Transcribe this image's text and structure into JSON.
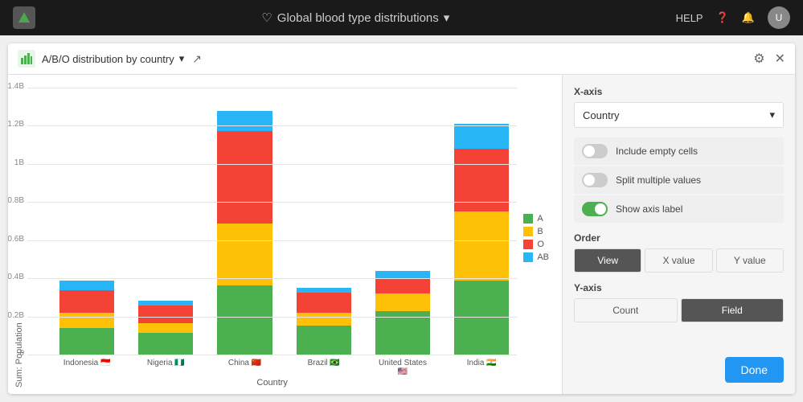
{
  "topbar": {
    "title": "Global blood type distributions",
    "help_label": "HELP",
    "heart_icon": "♡",
    "chevron_icon": "▾"
  },
  "panel": {
    "title": "A/B/O distribution by country",
    "chevron_icon": "▾",
    "export_icon": "↗",
    "settings_icon": "⚙",
    "close_icon": "✕"
  },
  "chart": {
    "y_axis_label": "Sum: Population",
    "x_axis_label": "Country",
    "grid_labels": [
      "1.4B",
      "1.2B",
      "1B",
      "0.8B",
      "0.6B",
      "0.4B",
      "0.2B",
      "0"
    ],
    "legend": [
      {
        "label": "A",
        "color": "#4caf50"
      },
      {
        "label": "B",
        "color": "#ffc107"
      },
      {
        "label": "O",
        "color": "#f44336"
      },
      {
        "label": "AB",
        "color": "#29b6f6"
      }
    ],
    "bars": [
      {
        "country": "Indonesia 🇮🇩",
        "segments": [
          {
            "type": "A",
            "color": "#4caf50",
            "height_pct": 11
          },
          {
            "type": "B",
            "color": "#ffc107",
            "height_pct": 6
          },
          {
            "type": "O",
            "color": "#f44336",
            "height_pct": 9
          },
          {
            "type": "AB",
            "color": "#29b6f6",
            "height_pct": 4
          }
        ],
        "total_pct": 30
      },
      {
        "country": "Nigeria 🇳🇬",
        "segments": [
          {
            "type": "A",
            "color": "#4caf50",
            "height_pct": 9
          },
          {
            "type": "B",
            "color": "#ffc107",
            "height_pct": 4
          },
          {
            "type": "O",
            "color": "#f44336",
            "height_pct": 7
          },
          {
            "type": "AB",
            "color": "#29b6f6",
            "height_pct": 2
          }
        ],
        "total_pct": 22
      },
      {
        "country": "China 🇨🇳",
        "segments": [
          {
            "type": "A",
            "color": "#4caf50",
            "height_pct": 28
          },
          {
            "type": "B",
            "color": "#ffc107",
            "height_pct": 25
          },
          {
            "type": "O",
            "color": "#f44336",
            "height_pct": 37
          },
          {
            "type": "AB",
            "color": "#29b6f6",
            "height_pct": 8
          }
        ],
        "total_pct": 98
      },
      {
        "country": "Brazil 🇧🇷",
        "segments": [
          {
            "type": "A",
            "color": "#4caf50",
            "height_pct": 12
          },
          {
            "type": "B",
            "color": "#ffc107",
            "height_pct": 5
          },
          {
            "type": "O",
            "color": "#f44336",
            "height_pct": 8
          },
          {
            "type": "AB",
            "color": "#29b6f6",
            "height_pct": 2
          }
        ],
        "total_pct": 27
      },
      {
        "country": "United States 🇺🇸",
        "segments": [
          {
            "type": "A",
            "color": "#4caf50",
            "height_pct": 18
          },
          {
            "type": "B",
            "color": "#ffc107",
            "height_pct": 7
          },
          {
            "type": "O",
            "color": "#f44336",
            "height_pct": 6
          },
          {
            "type": "AB",
            "color": "#29b6f6",
            "height_pct": 3
          }
        ],
        "total_pct": 34
      },
      {
        "country": "India 🇮🇳",
        "segments": [
          {
            "type": "A",
            "color": "#4caf50",
            "height_pct": 30
          },
          {
            "type": "B",
            "color": "#ffc107",
            "height_pct": 28
          },
          {
            "type": "O",
            "color": "#f44336",
            "height_pct": 25
          },
          {
            "type": "AB",
            "color": "#29b6f6",
            "height_pct": 10
          }
        ],
        "total_pct": 93
      }
    ]
  },
  "right_panel": {
    "x_axis_section_label": "X-axis",
    "x_axis_dropdown_value": "Country",
    "x_axis_dropdown_chevron": "▾",
    "include_empty_label": "Include empty cells",
    "split_multiple_label": "Split multiple values",
    "show_axis_label": "Show axis label",
    "order_section_label": "Order",
    "order_buttons": [
      {
        "label": "View",
        "state": "active"
      },
      {
        "label": "X value",
        "state": "inactive"
      },
      {
        "label": "Y value",
        "state": "inactive"
      }
    ],
    "y_axis_section_label": "Y-axis",
    "y_axis_buttons": [
      {
        "label": "Count",
        "state": "inactive"
      },
      {
        "label": "Field",
        "state": "active"
      }
    ],
    "done_label": "Done"
  }
}
